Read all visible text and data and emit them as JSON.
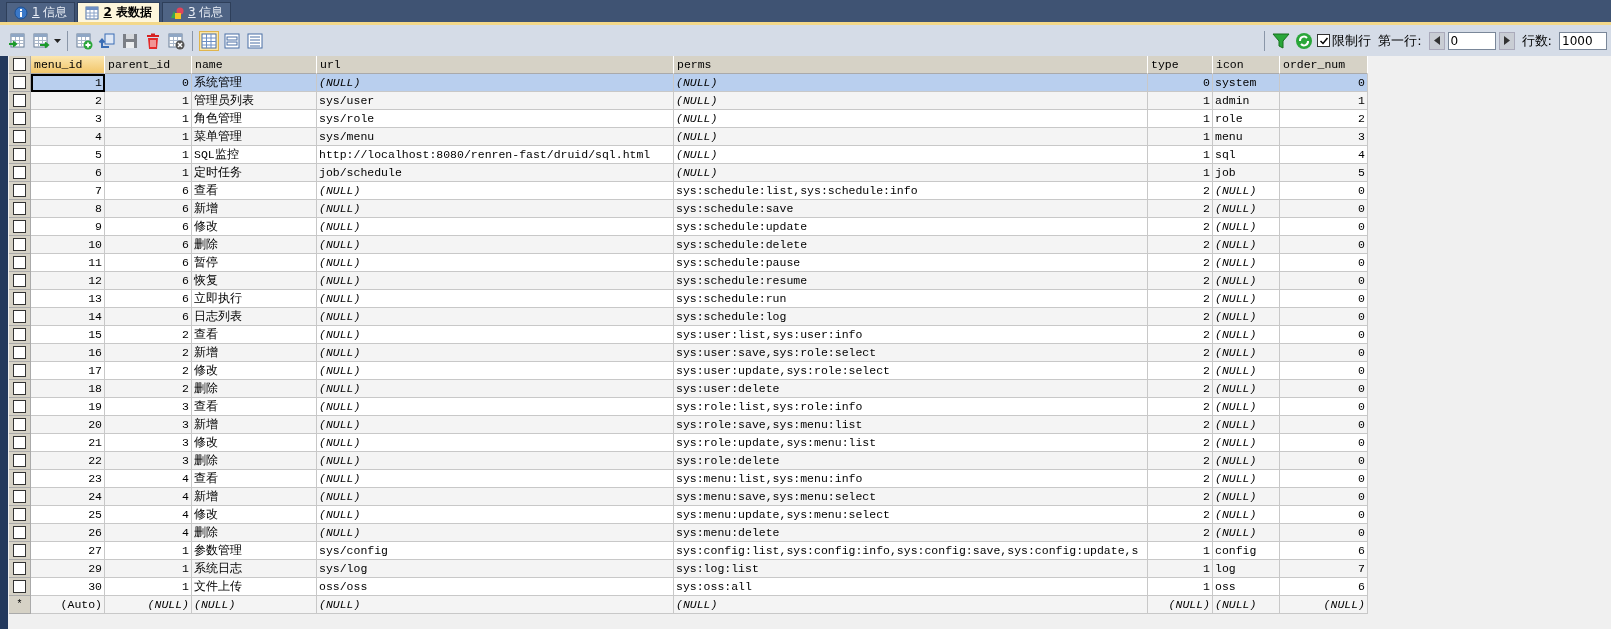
{
  "tabs": [
    {
      "key": "1",
      "label": "信息",
      "kind": "info",
      "selected": false
    },
    {
      "key": "2",
      "label": "表数据",
      "kind": "table",
      "selected": true
    },
    {
      "key": "3",
      "label": "信息",
      "kind": "shapes",
      "selected": false
    }
  ],
  "toolbar": {
    "view_buttons": [
      {
        "selected": true
      },
      {
        "selected": false
      },
      {
        "selected": false
      }
    ],
    "limit_rows": {
      "label": "限制行",
      "checked": true
    },
    "first_row": {
      "label": "第一行:",
      "value": "0"
    },
    "row_count": {
      "label": "行数:",
      "value": "1000"
    }
  },
  "table": {
    "header_checkbox": {
      "checked": false
    },
    "columns": [
      {
        "label": "menu_id",
        "kind": "number",
        "selected": true
      },
      {
        "label": "parent_id",
        "kind": "number",
        "selected": false
      },
      {
        "label": "name",
        "kind": "text",
        "selected": false
      },
      {
        "label": "url",
        "kind": "text",
        "selected": false
      },
      {
        "label": "perms",
        "kind": "text",
        "selected": false
      },
      {
        "label": "type",
        "kind": "number",
        "selected": false
      },
      {
        "label": "icon",
        "kind": "text",
        "selected": false
      },
      {
        "label": "order_num",
        "kind": "number",
        "selected": false
      }
    ],
    "rows": [
      {
        "kind": "data",
        "selected": true,
        "checked": false,
        "cells": [
          "1",
          "0",
          "系统管理",
          {
            "null": "(NULL)"
          },
          {
            "null": "(NULL)"
          },
          "0",
          "system",
          "0"
        ]
      },
      {
        "kind": "data",
        "selected": false,
        "checked": false,
        "cells": [
          "2",
          "1",
          "管理员列表",
          "sys/user",
          {
            "null": "(NULL)"
          },
          "1",
          "admin",
          "1"
        ]
      },
      {
        "kind": "data",
        "selected": false,
        "checked": false,
        "cells": [
          "3",
          "1",
          "角色管理",
          "sys/role",
          {
            "null": "(NULL)"
          },
          "1",
          "role",
          "2"
        ]
      },
      {
        "kind": "data",
        "selected": false,
        "checked": false,
        "cells": [
          "4",
          "1",
          "菜单管理",
          "sys/menu",
          {
            "null": "(NULL)"
          },
          "1",
          "menu",
          "3"
        ]
      },
      {
        "kind": "data",
        "selected": false,
        "checked": false,
        "cells": [
          "5",
          "1",
          "SQL监控",
          "http://localhost:8080/renren-fast/druid/sql.html",
          {
            "null": "(NULL)"
          },
          "1",
          "sql",
          "4"
        ]
      },
      {
        "kind": "data",
        "selected": false,
        "checked": false,
        "cells": [
          "6",
          "1",
          "定时任务",
          "job/schedule",
          {
            "null": "(NULL)"
          },
          "1",
          "job",
          "5"
        ]
      },
      {
        "kind": "data",
        "selected": false,
        "checked": false,
        "cells": [
          "7",
          "6",
          "查看",
          {
            "null": "(NULL)"
          },
          "sys:schedule:list,sys:schedule:info",
          "2",
          {
            "null": "(NULL)"
          },
          "0"
        ]
      },
      {
        "kind": "data",
        "selected": false,
        "checked": false,
        "cells": [
          "8",
          "6",
          "新增",
          {
            "null": "(NULL)"
          },
          "sys:schedule:save",
          "2",
          {
            "null": "(NULL)"
          },
          "0"
        ]
      },
      {
        "kind": "data",
        "selected": false,
        "checked": false,
        "cells": [
          "9",
          "6",
          "修改",
          {
            "null": "(NULL)"
          },
          "sys:schedule:update",
          "2",
          {
            "null": "(NULL)"
          },
          "0"
        ]
      },
      {
        "kind": "data",
        "selected": false,
        "checked": false,
        "cells": [
          "10",
          "6",
          "删除",
          {
            "null": "(NULL)"
          },
          "sys:schedule:delete",
          "2",
          {
            "null": "(NULL)"
          },
          "0"
        ]
      },
      {
        "kind": "data",
        "selected": false,
        "checked": false,
        "cells": [
          "11",
          "6",
          "暂停",
          {
            "null": "(NULL)"
          },
          "sys:schedule:pause",
          "2",
          {
            "null": "(NULL)"
          },
          "0"
        ]
      },
      {
        "kind": "data",
        "selected": false,
        "checked": false,
        "cells": [
          "12",
          "6",
          "恢复",
          {
            "null": "(NULL)"
          },
          "sys:schedule:resume",
          "2",
          {
            "null": "(NULL)"
          },
          "0"
        ]
      },
      {
        "kind": "data",
        "selected": false,
        "checked": false,
        "cells": [
          "13",
          "6",
          "立即执行",
          {
            "null": "(NULL)"
          },
          "sys:schedule:run",
          "2",
          {
            "null": "(NULL)"
          },
          "0"
        ]
      },
      {
        "kind": "data",
        "selected": false,
        "checked": false,
        "cells": [
          "14",
          "6",
          "日志列表",
          {
            "null": "(NULL)"
          },
          "sys:schedule:log",
          "2",
          {
            "null": "(NULL)"
          },
          "0"
        ]
      },
      {
        "kind": "data",
        "selected": false,
        "checked": false,
        "cells": [
          "15",
          "2",
          "查看",
          {
            "null": "(NULL)"
          },
          "sys:user:list,sys:user:info",
          "2",
          {
            "null": "(NULL)"
          },
          "0"
        ]
      },
      {
        "kind": "data",
        "selected": false,
        "checked": false,
        "cells": [
          "16",
          "2",
          "新增",
          {
            "null": "(NULL)"
          },
          "sys:user:save,sys:role:select",
          "2",
          {
            "null": "(NULL)"
          },
          "0"
        ]
      },
      {
        "kind": "data",
        "selected": false,
        "checked": false,
        "cells": [
          "17",
          "2",
          "修改",
          {
            "null": "(NULL)"
          },
          "sys:user:update,sys:role:select",
          "2",
          {
            "null": "(NULL)"
          },
          "0"
        ]
      },
      {
        "kind": "data",
        "selected": false,
        "checked": false,
        "cells": [
          "18",
          "2",
          "删除",
          {
            "null": "(NULL)"
          },
          "sys:user:delete",
          "2",
          {
            "null": "(NULL)"
          },
          "0"
        ]
      },
      {
        "kind": "data",
        "selected": false,
        "checked": false,
        "cells": [
          "19",
          "3",
          "查看",
          {
            "null": "(NULL)"
          },
          "sys:role:list,sys:role:info",
          "2",
          {
            "null": "(NULL)"
          },
          "0"
        ]
      },
      {
        "kind": "data",
        "selected": false,
        "checked": false,
        "cells": [
          "20",
          "3",
          "新增",
          {
            "null": "(NULL)"
          },
          "sys:role:save,sys:menu:list",
          "2",
          {
            "null": "(NULL)"
          },
          "0"
        ]
      },
      {
        "kind": "data",
        "selected": false,
        "checked": false,
        "cells": [
          "21",
          "3",
          "修改",
          {
            "null": "(NULL)"
          },
          "sys:role:update,sys:menu:list",
          "2",
          {
            "null": "(NULL)"
          },
          "0"
        ]
      },
      {
        "kind": "data",
        "selected": false,
        "checked": false,
        "cells": [
          "22",
          "3",
          "删除",
          {
            "null": "(NULL)"
          },
          "sys:role:delete",
          "2",
          {
            "null": "(NULL)"
          },
          "0"
        ]
      },
      {
        "kind": "data",
        "selected": false,
        "checked": false,
        "cells": [
          "23",
          "4",
          "查看",
          {
            "null": "(NULL)"
          },
          "sys:menu:list,sys:menu:info",
          "2",
          {
            "null": "(NULL)"
          },
          "0"
        ]
      },
      {
        "kind": "data",
        "selected": false,
        "checked": false,
        "cells": [
          "24",
          "4",
          "新增",
          {
            "null": "(NULL)"
          },
          "sys:menu:save,sys:menu:select",
          "2",
          {
            "null": "(NULL)"
          },
          "0"
        ]
      },
      {
        "kind": "data",
        "selected": false,
        "checked": false,
        "cells": [
          "25",
          "4",
          "修改",
          {
            "null": "(NULL)"
          },
          "sys:menu:update,sys:menu:select",
          "2",
          {
            "null": "(NULL)"
          },
          "0"
        ]
      },
      {
        "kind": "data",
        "selected": false,
        "checked": false,
        "cells": [
          "26",
          "4",
          "删除",
          {
            "null": "(NULL)"
          },
          "sys:menu:delete",
          "2",
          {
            "null": "(NULL)"
          },
          "0"
        ]
      },
      {
        "kind": "data",
        "selected": false,
        "checked": false,
        "cells": [
          "27",
          "1",
          "参数管理",
          "sys/config",
          "sys:config:list,sys:config:info,sys:config:save,sys:config:update,s",
          "1",
          "config",
          "6"
        ]
      },
      {
        "kind": "data",
        "selected": false,
        "checked": false,
        "cells": [
          "29",
          "1",
          "系统日志",
          "sys/log",
          "sys:log:list",
          "1",
          "log",
          "7"
        ]
      },
      {
        "kind": "data",
        "selected": false,
        "checked": false,
        "cells": [
          "30",
          "1",
          "文件上传",
          "oss/oss",
          "sys:oss:all",
          "1",
          "oss",
          "6"
        ]
      },
      {
        "kind": "new",
        "marker": "*",
        "selected": false,
        "cells": [
          "(Auto)",
          {
            "null": "(NULL)"
          },
          {
            "null": "(NULL)"
          },
          {
            "null": "(NULL)"
          },
          {
            "null": "(NULL)"
          },
          {
            "null": "(NULL)"
          },
          {
            "null": "(NULL)"
          },
          {
            "null": "(NULL)"
          }
        ]
      }
    ]
  }
}
